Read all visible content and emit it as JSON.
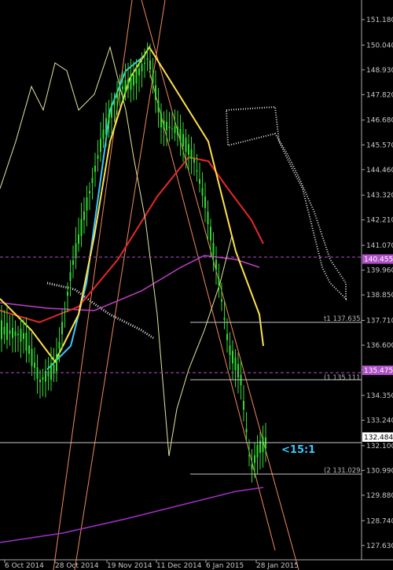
{
  "chart_data": {
    "type": "candlestick",
    "ylim": [
      127.2,
      151.6
    ],
    "y_ticks": [
      151.18,
      150.04,
      148.93,
      147.82,
      146.68,
      145.57,
      144.46,
      143.32,
      142.21,
      141.07,
      139.96,
      138.85,
      137.71,
      136.6,
      135.49,
      134.35,
      133.24,
      132.1,
      130.99,
      129.88,
      128.74,
      127.63
    ],
    "x_ticks": [
      "6 Oct 2014",
      "28 Oct 2014",
      "19 Nov 2014",
      "11 Dec 2014",
      "6 Jan 2015",
      "28 Jan 2015"
    ],
    "grid": false,
    "price_tags": [
      {
        "text": "140.455",
        "value": 140.455,
        "color": "#b050c8"
      },
      {
        "text": "135.475",
        "value": 135.475,
        "color": "#b050c8"
      },
      {
        "text": "132.484",
        "value": 132.484,
        "color": "#ffffff"
      }
    ],
    "levels": [
      {
        "label": "t1 137.635",
        "value": 137.635
      },
      {
        "label": "(1 135.111",
        "value": 135.111
      },
      {
        "label": "(2 131.029",
        "value": 131.029
      }
    ],
    "annotation": "<15:1",
    "colors": {
      "background": "#000000",
      "candles": "#32dc32",
      "ichimoku": "#e6e6e6",
      "long_ma": "#a030c8",
      "fast_ma": "#ffe24a",
      "blue_ma": "#3cc8ff",
      "red_ma": "#e62828",
      "lagging": "#e6e6a0",
      "channel": "#f08a5a"
    }
  }
}
